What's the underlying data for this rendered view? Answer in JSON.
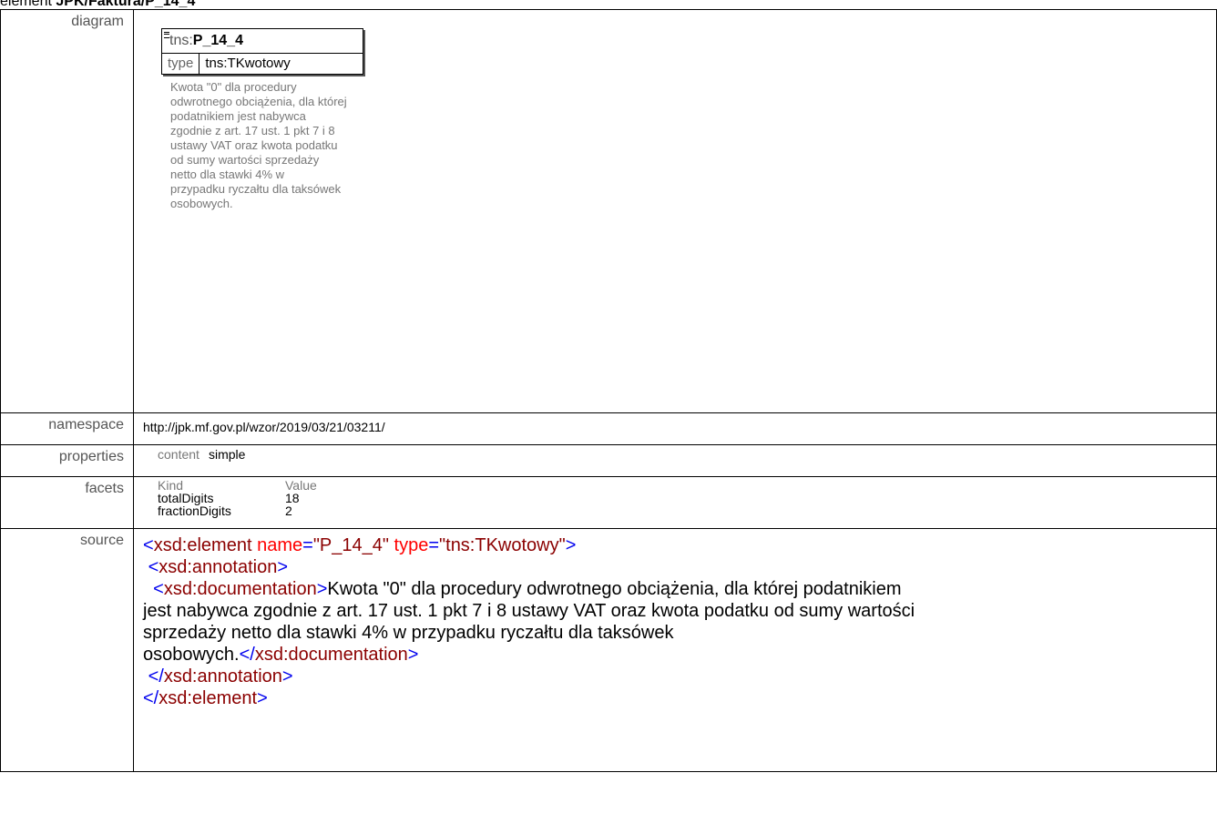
{
  "heading": {
    "prefix": "element ",
    "path": "JPK/Faktura/P_14_4"
  },
  "rows": {
    "diagram_label": "diagram",
    "namespace_label": "namespace",
    "properties_label": "properties",
    "facets_label": "facets",
    "source_label": "source"
  },
  "diagram": {
    "prefix": "tns:",
    "name": "P_14_4",
    "type_key": "type",
    "type_value": "tns:TKwotowy",
    "doc_lines": [
      "Kwota \"0\" dla procedury",
      "odwrotnego obciążenia, dla której",
      "podatnikiem jest nabywca",
      "zgodnie z art. 17 ust. 1 pkt 7 i 8",
      "ustawy VAT oraz kwota podatku",
      "od sumy wartości sprzedaży",
      "netto dla stawki 4% w",
      "przypadku ryczałtu dla taksówek",
      "osobowych."
    ]
  },
  "namespace": "http://jpk.mf.gov.pl/wzor/2019/03/21/03211/",
  "properties": {
    "key": "content",
    "value": "simple"
  },
  "facets": {
    "header": [
      "Kind",
      "Value"
    ],
    "rows": [
      [
        "totalDigits",
        "18"
      ],
      [
        "fractionDigits",
        "2"
      ]
    ]
  },
  "source": {
    "open_lt": "<",
    "element_tag": "xsd:element",
    "name_attr": "name",
    "eq": "=",
    "name_val": "\"P_14_4\"",
    "type_attr": "type",
    "type_val": "\"tns:TKwotowy\"",
    "gt": ">",
    "annotation_tag": "xsd:annotation",
    "documentation_tag": "xsd:documentation",
    "doc_line1": "Kwota \"0\" dla procedury odwrotnego obciążenia, dla której podatnikiem",
    "doc_line2": "jest nabywca zgodnie z art. 17 ust. 1 pkt 7 i 8 ustawy VAT oraz kwota podatku od sumy wartości",
    "doc_line3": "sprzedaży netto dla stawki 4% w przypadku ryczałtu dla taksówek",
    "doc_line4": "osobowych.",
    "close_lt": "</",
    "space": " "
  }
}
